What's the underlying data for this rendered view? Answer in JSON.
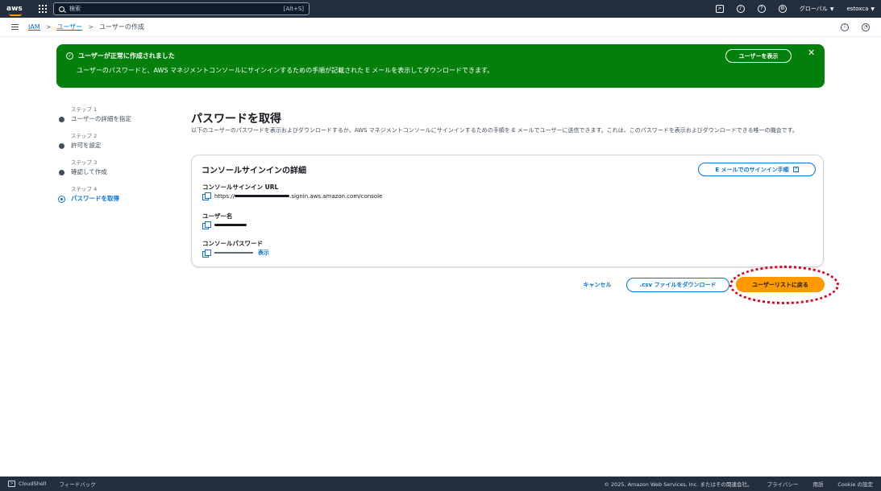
{
  "topnav": {
    "logo": "aws",
    "search_placeholder": "検索",
    "search_shortcut": "[Alt+S]",
    "icons": [
      "cloudshell-icon",
      "bell-icon",
      "help-icon",
      "gear-icon"
    ],
    "region": "グローバル",
    "account": "estoxca"
  },
  "breadcrumb": {
    "items": [
      "IAM",
      "ユーザー",
      "ユーザーの作成"
    ]
  },
  "flash": {
    "title": "ユーザーが正常に作成されました",
    "message": "ユーザーのパスワードと、AWS マネジメントコンソールにサインインするための手順が記載された E メールを表示してダウンロードできます。",
    "view_button": "ユーザーを表示",
    "color": "#037f0c"
  },
  "steps": [
    {
      "num": "ステップ 1",
      "label": "ユーザーの詳細を指定"
    },
    {
      "num": "ステップ 2",
      "label": "許可を設定"
    },
    {
      "num": "ステップ 3",
      "label": "確認して作成"
    },
    {
      "num": "ステップ 4",
      "label": "パスワードを取得"
    }
  ],
  "main": {
    "title": "パスワードを取得",
    "description": "以下のユーザーのパスワードを表示およびダウンロードするか、AWS マネジメントコンソールにサインインするための手順を E メールでユーザーに送信できます。これは、このパスワードを表示およびダウンロードできる唯一の機会です。"
  },
  "card": {
    "title": "コンソールサインインの詳細",
    "email_button": "E メールでのサインイン手順",
    "url_label": "コンソールサインイン URL",
    "url_prefix": "https://",
    "url_suffix": ".signin.aws.amazon.com/console",
    "username_label": "ユーザー名",
    "password_label": "コンソールパスワード",
    "show_link": "表示"
  },
  "actions": {
    "cancel": "キャンセル",
    "download_csv": ".csv ファイルをダウンロード",
    "return_to_list": "ユーザーリストに戻る",
    "accent": "#ff9900"
  },
  "footer": {
    "cloudshell": "CloudShell",
    "feedback": "フィードバック",
    "copyright": "© 2025, Amazon Web Services, Inc. またはその関連会社。",
    "privacy": "プライバシー",
    "terms": "用語",
    "cookie": "Cookie の設定"
  }
}
